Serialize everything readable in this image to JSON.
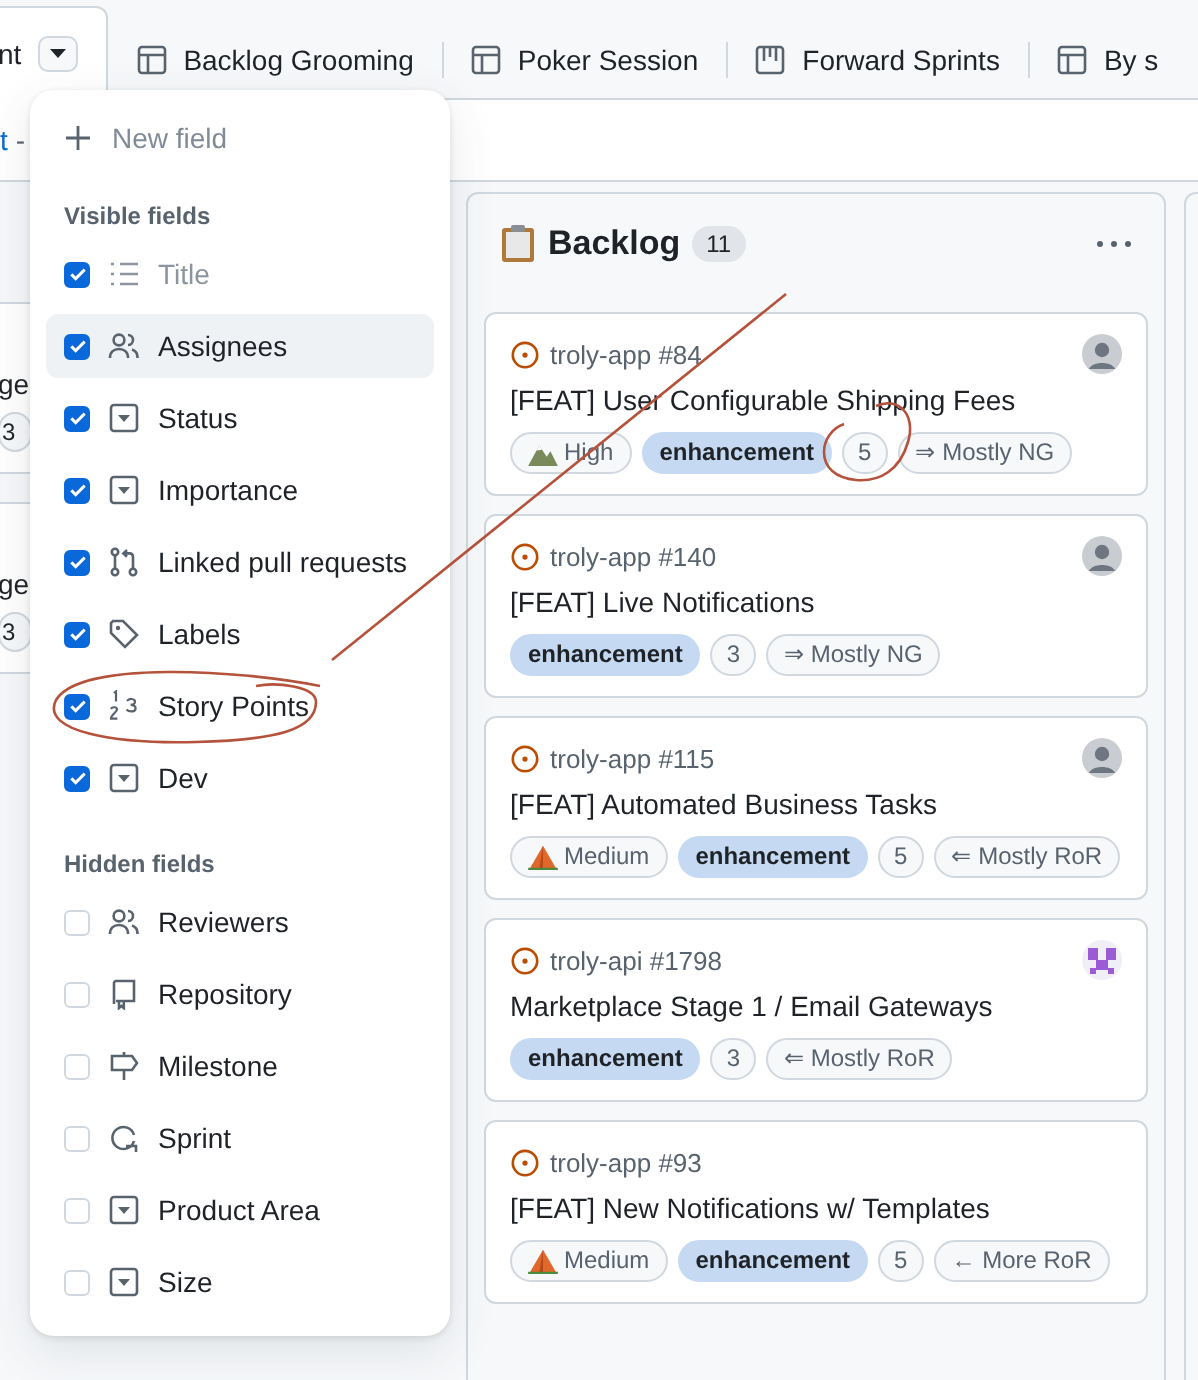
{
  "tabs": [
    {
      "label": "nt",
      "kind": "plain",
      "selected": true,
      "dropdown": true
    },
    {
      "label": "Backlog Grooming",
      "kind": "table",
      "selected": false,
      "dropdown": false
    },
    {
      "label": "Poker Session",
      "kind": "table",
      "selected": false,
      "dropdown": false
    },
    {
      "label": "Forward Sprints",
      "kind": "board",
      "selected": false,
      "dropdown": false
    },
    {
      "label": "By s",
      "kind": "table",
      "selected": false,
      "dropdown": false
    }
  ],
  "filter_bar": {
    "link": "t",
    "separator": "-"
  },
  "left_column": {
    "cards": [
      {
        "line": "ge",
        "count": "3"
      },
      {
        "line": "ge",
        "count": "3"
      }
    ]
  },
  "field_menu": {
    "new_field": "New field",
    "sections": [
      {
        "heading": "Visible fields",
        "fields": [
          {
            "label": "Title",
            "kind": "list",
            "checked": true,
            "disabled": true,
            "highlighted": false
          },
          {
            "label": "Assignees",
            "kind": "people",
            "checked": true,
            "disabled": false,
            "highlighted": true
          },
          {
            "label": "Status",
            "kind": "select",
            "checked": true,
            "disabled": false,
            "highlighted": false
          },
          {
            "label": "Importance",
            "kind": "select",
            "checked": true,
            "disabled": false,
            "highlighted": false
          },
          {
            "label": "Linked pull requests",
            "kind": "pull",
            "checked": true,
            "disabled": false,
            "highlighted": false
          },
          {
            "label": "Labels",
            "kind": "tag",
            "checked": true,
            "disabled": false,
            "highlighted": false
          },
          {
            "label": "Story Points",
            "kind": "number",
            "checked": true,
            "disabled": false,
            "highlighted": false
          },
          {
            "label": "Dev",
            "kind": "select",
            "checked": true,
            "disabled": false,
            "highlighted": false
          }
        ]
      },
      {
        "heading": "Hidden fields",
        "fields": [
          {
            "label": "Reviewers",
            "kind": "people",
            "checked": false,
            "disabled": false,
            "highlighted": false
          },
          {
            "label": "Repository",
            "kind": "repo",
            "checked": false,
            "disabled": false,
            "highlighted": false
          },
          {
            "label": "Milestone",
            "kind": "milestone",
            "checked": false,
            "disabled": false,
            "highlighted": false
          },
          {
            "label": "Sprint",
            "kind": "iteration",
            "checked": false,
            "disabled": false,
            "highlighted": false
          },
          {
            "label": "Product Area",
            "kind": "select",
            "checked": false,
            "disabled": false,
            "highlighted": false
          },
          {
            "label": "Size",
            "kind": "select",
            "checked": false,
            "disabled": false,
            "highlighted": false
          }
        ]
      }
    ]
  },
  "column": {
    "title": "Backlog",
    "count": "11",
    "cards": [
      {
        "repo": "troly-app #84",
        "title": "[FEAT] User Configurable Shipping Fees",
        "avatar": {
          "kind": "photo"
        },
        "tags": [
          {
            "kind": "priority",
            "emoji": {
              "kind": "mountain"
            },
            "text": "High"
          },
          {
            "kind": "label",
            "text": "enhancement"
          },
          {
            "kind": "points",
            "text": "5"
          },
          {
            "kind": "dev",
            "text": "⇒ Mostly NG"
          }
        ]
      },
      {
        "repo": "troly-app #140",
        "title": "[FEAT] Live Notifications",
        "avatar": {
          "kind": "photo"
        },
        "tags": [
          {
            "kind": "label",
            "text": "enhancement"
          },
          {
            "kind": "points",
            "text": "3"
          },
          {
            "kind": "dev",
            "text": "⇒ Mostly NG"
          }
        ]
      },
      {
        "repo": "troly-app #115",
        "title": "[FEAT] Automated Business Tasks",
        "avatar": {
          "kind": "photo"
        },
        "tags": [
          {
            "kind": "priority",
            "emoji": {
              "kind": "tent"
            },
            "text": "Medium"
          },
          {
            "kind": "label",
            "text": "enhancement"
          },
          {
            "kind": "points",
            "text": "5"
          },
          {
            "kind": "dev",
            "text": "⇐ Mostly RoR"
          }
        ]
      },
      {
        "repo": "troly-api #1798",
        "title": "Marketplace Stage 1 / Email Gateways",
        "avatar": {
          "kind": "identicon"
        },
        "tags": [
          {
            "kind": "label",
            "text": "enhancement"
          },
          {
            "kind": "points",
            "text": "3"
          },
          {
            "kind": "dev",
            "text": "⇐ Mostly RoR"
          }
        ]
      },
      {
        "repo": "troly-app #93",
        "title": "[FEAT] New Notifications w/ Templates",
        "tags": [
          {
            "kind": "priority",
            "emoji": {
              "kind": "tent"
            },
            "text": "Medium"
          },
          {
            "kind": "label",
            "text": "enhancement"
          },
          {
            "kind": "points",
            "text": "5"
          },
          {
            "kind": "dev",
            "text": "← More RoR"
          }
        ]
      }
    ]
  }
}
